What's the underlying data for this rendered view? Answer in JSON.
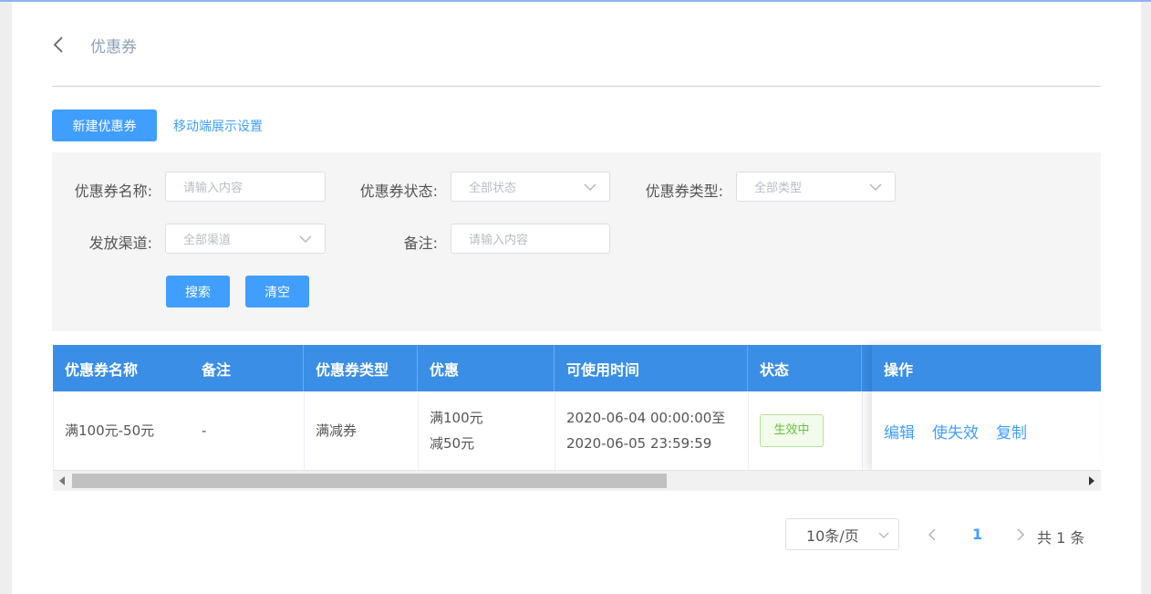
{
  "header": {
    "title": "优惠券"
  },
  "toolbar": {
    "new_label": "新建优惠券",
    "mobile_settings_label": "移动端展示设置"
  },
  "filters": {
    "name_label": "优惠券名称:",
    "name_placeholder": "请输入内容",
    "status_label": "优惠券状态:",
    "status_value": "全部状态",
    "type_label": "优惠券类型:",
    "type_value": "全部类型",
    "channel_label": "发放渠道:",
    "channel_value": "全部渠道",
    "remark_label": "备注:",
    "remark_placeholder": "请输入内容",
    "search_label": "搜索",
    "clear_label": "清空"
  },
  "table": {
    "columns": [
      "优惠券名称",
      "备注",
      "优惠券类型",
      "优惠",
      "可使用时间",
      "状态",
      "操作"
    ],
    "rows": [
      {
        "name": "满100元-50元",
        "remark": "-",
        "type": "满减券",
        "discount_line1": "满100元",
        "discount_line2": "减50元",
        "time_line1": "2020-06-04 00:00:00至",
        "time_line2": "2020-06-05 23:59:59",
        "status": "生效中",
        "actions": [
          "编辑",
          "使失效",
          "复制"
        ]
      }
    ]
  },
  "pagination": {
    "page_size": "10条/页",
    "current_page": "1",
    "total": "共 1 条"
  },
  "colors": {
    "primary": "#409eff",
    "header_bg": "#3a8ee6",
    "success": "#67c23a"
  }
}
